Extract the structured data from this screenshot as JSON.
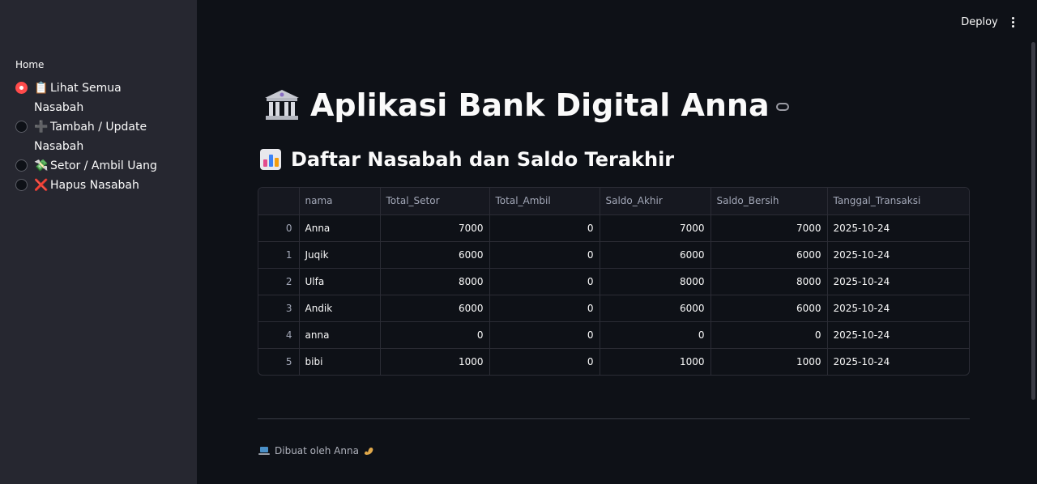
{
  "sidebar": {
    "label": "Home",
    "options": [
      {
        "emoji": "📋",
        "label": "Lihat Semua Nasabah",
        "selected": true
      },
      {
        "emoji": "➕",
        "label": "Tambah / Update Nasabah",
        "selected": false
      },
      {
        "emoji": "💸",
        "label": "Setor / Ambil Uang",
        "selected": false
      },
      {
        "emoji": "❌",
        "label": "Hapus Nasabah",
        "selected": false
      }
    ]
  },
  "header": {
    "deploy_label": "Deploy",
    "menu_icon": "kebab-menu-icon"
  },
  "main": {
    "title": "Aplikasi Bank Digital Anna",
    "title_icon": "bank-icon",
    "subtitle": "Daftar Nasabah dan Saldo Terakhir",
    "subtitle_icon": "bar-chart-icon"
  },
  "table": {
    "columns": [
      "",
      "nama",
      "Total_Setor",
      "Total_Ambil",
      "Saldo_Akhir",
      "Saldo_Bersih",
      "Tanggal_Transaksi"
    ],
    "rows": [
      [
        "0",
        "Anna",
        "7000",
        "0",
        "7000",
        "7000",
        "2025-10-24"
      ],
      [
        "1",
        "Juqik",
        "6000",
        "0",
        "6000",
        "6000",
        "2025-10-24"
      ],
      [
        "2",
        "Ulfa",
        "8000",
        "0",
        "8000",
        "8000",
        "2025-10-24"
      ],
      [
        "3",
        "Andik",
        "6000",
        "0",
        "6000",
        "6000",
        "2025-10-24"
      ],
      [
        "4",
        "anna",
        "0",
        "0",
        "0",
        "0",
        "2025-10-24"
      ],
      [
        "5",
        "bibi",
        "1000",
        "0",
        "1000",
        "1000",
        "2025-10-24"
      ]
    ]
  },
  "footer": {
    "text": "Dibuat oleh Anna",
    "leading_icon": "laptop-icon",
    "trailing_icon": "flexed-arm-icon"
  },
  "colors": {
    "background": "#0e1117",
    "sidebar": "#262730",
    "accent": "#ff4b4b"
  }
}
